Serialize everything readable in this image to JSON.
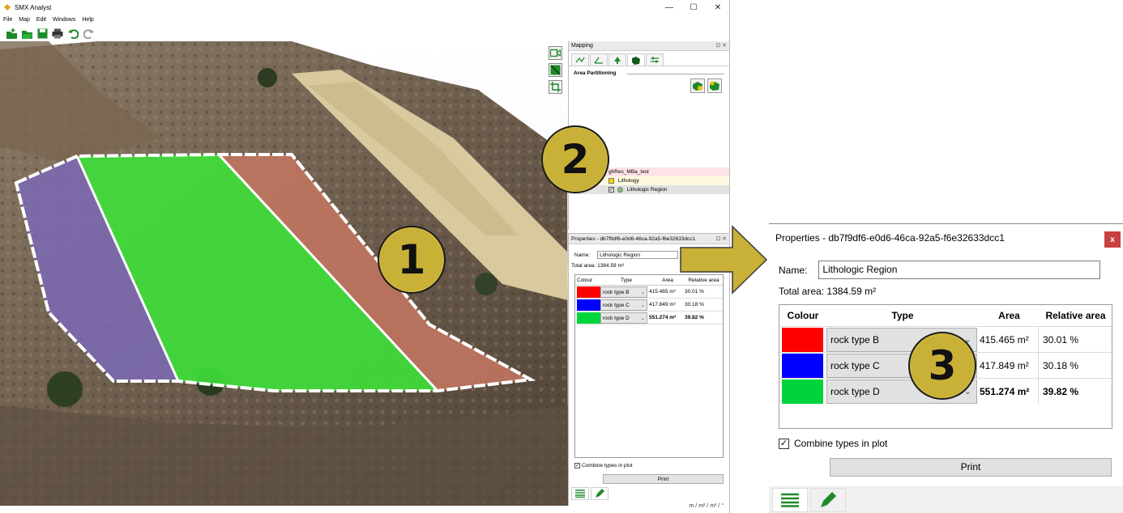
{
  "app": {
    "title": "SMX Analyst",
    "menu": [
      "File",
      "Map",
      "Edit",
      "Windows",
      "Help"
    ],
    "window_controls": {
      "minimize": "—",
      "maximize": "☐",
      "close": "✕"
    }
  },
  "callouts": {
    "one": "1",
    "two": "2",
    "three": "3"
  },
  "mapping_panel": {
    "title": "Mapping",
    "header_controls": "⊡ ✕",
    "section": "Area Partitioning"
  },
  "layers": [
    {
      "label": "ghRes_MBa_test"
    },
    {
      "label": "Lithology"
    },
    {
      "label": "Lithologic Region"
    }
  ],
  "properties": {
    "title": "Properties - db7f9df6-e0d6-46ca-92a5-f6e32633dcc1",
    "header_controls": "⊡ ✕",
    "close_label": "x",
    "name_label": "Name:",
    "name_value": "Lithologic Region",
    "total_area_label": "Total area:",
    "total_area_value": "1384.59 m²",
    "columns": [
      "Colour",
      "Type",
      "Area",
      "Relative area"
    ],
    "rows": [
      {
        "colour": "#ff0000",
        "type": "rock type B",
        "area": "415.465 m²",
        "relative": "30.01 %",
        "bold": false
      },
      {
        "colour": "#0000ff",
        "type": "rock type C",
        "area": "417.849 m²",
        "relative": "30.18 %",
        "bold": false
      },
      {
        "colour": "#00d43a",
        "type": "rock type D",
        "area": "551.274 m²",
        "relative": "39.82 %",
        "bold": true
      }
    ],
    "combine_label": "Combine types in plot",
    "combine_checked": "✓",
    "print_label": "Print"
  },
  "status": {
    "units": "m / m² / m³ / °"
  },
  "colors": {
    "callout": "#c9b037",
    "arrow": "#c9b037",
    "close": "#c94040"
  }
}
